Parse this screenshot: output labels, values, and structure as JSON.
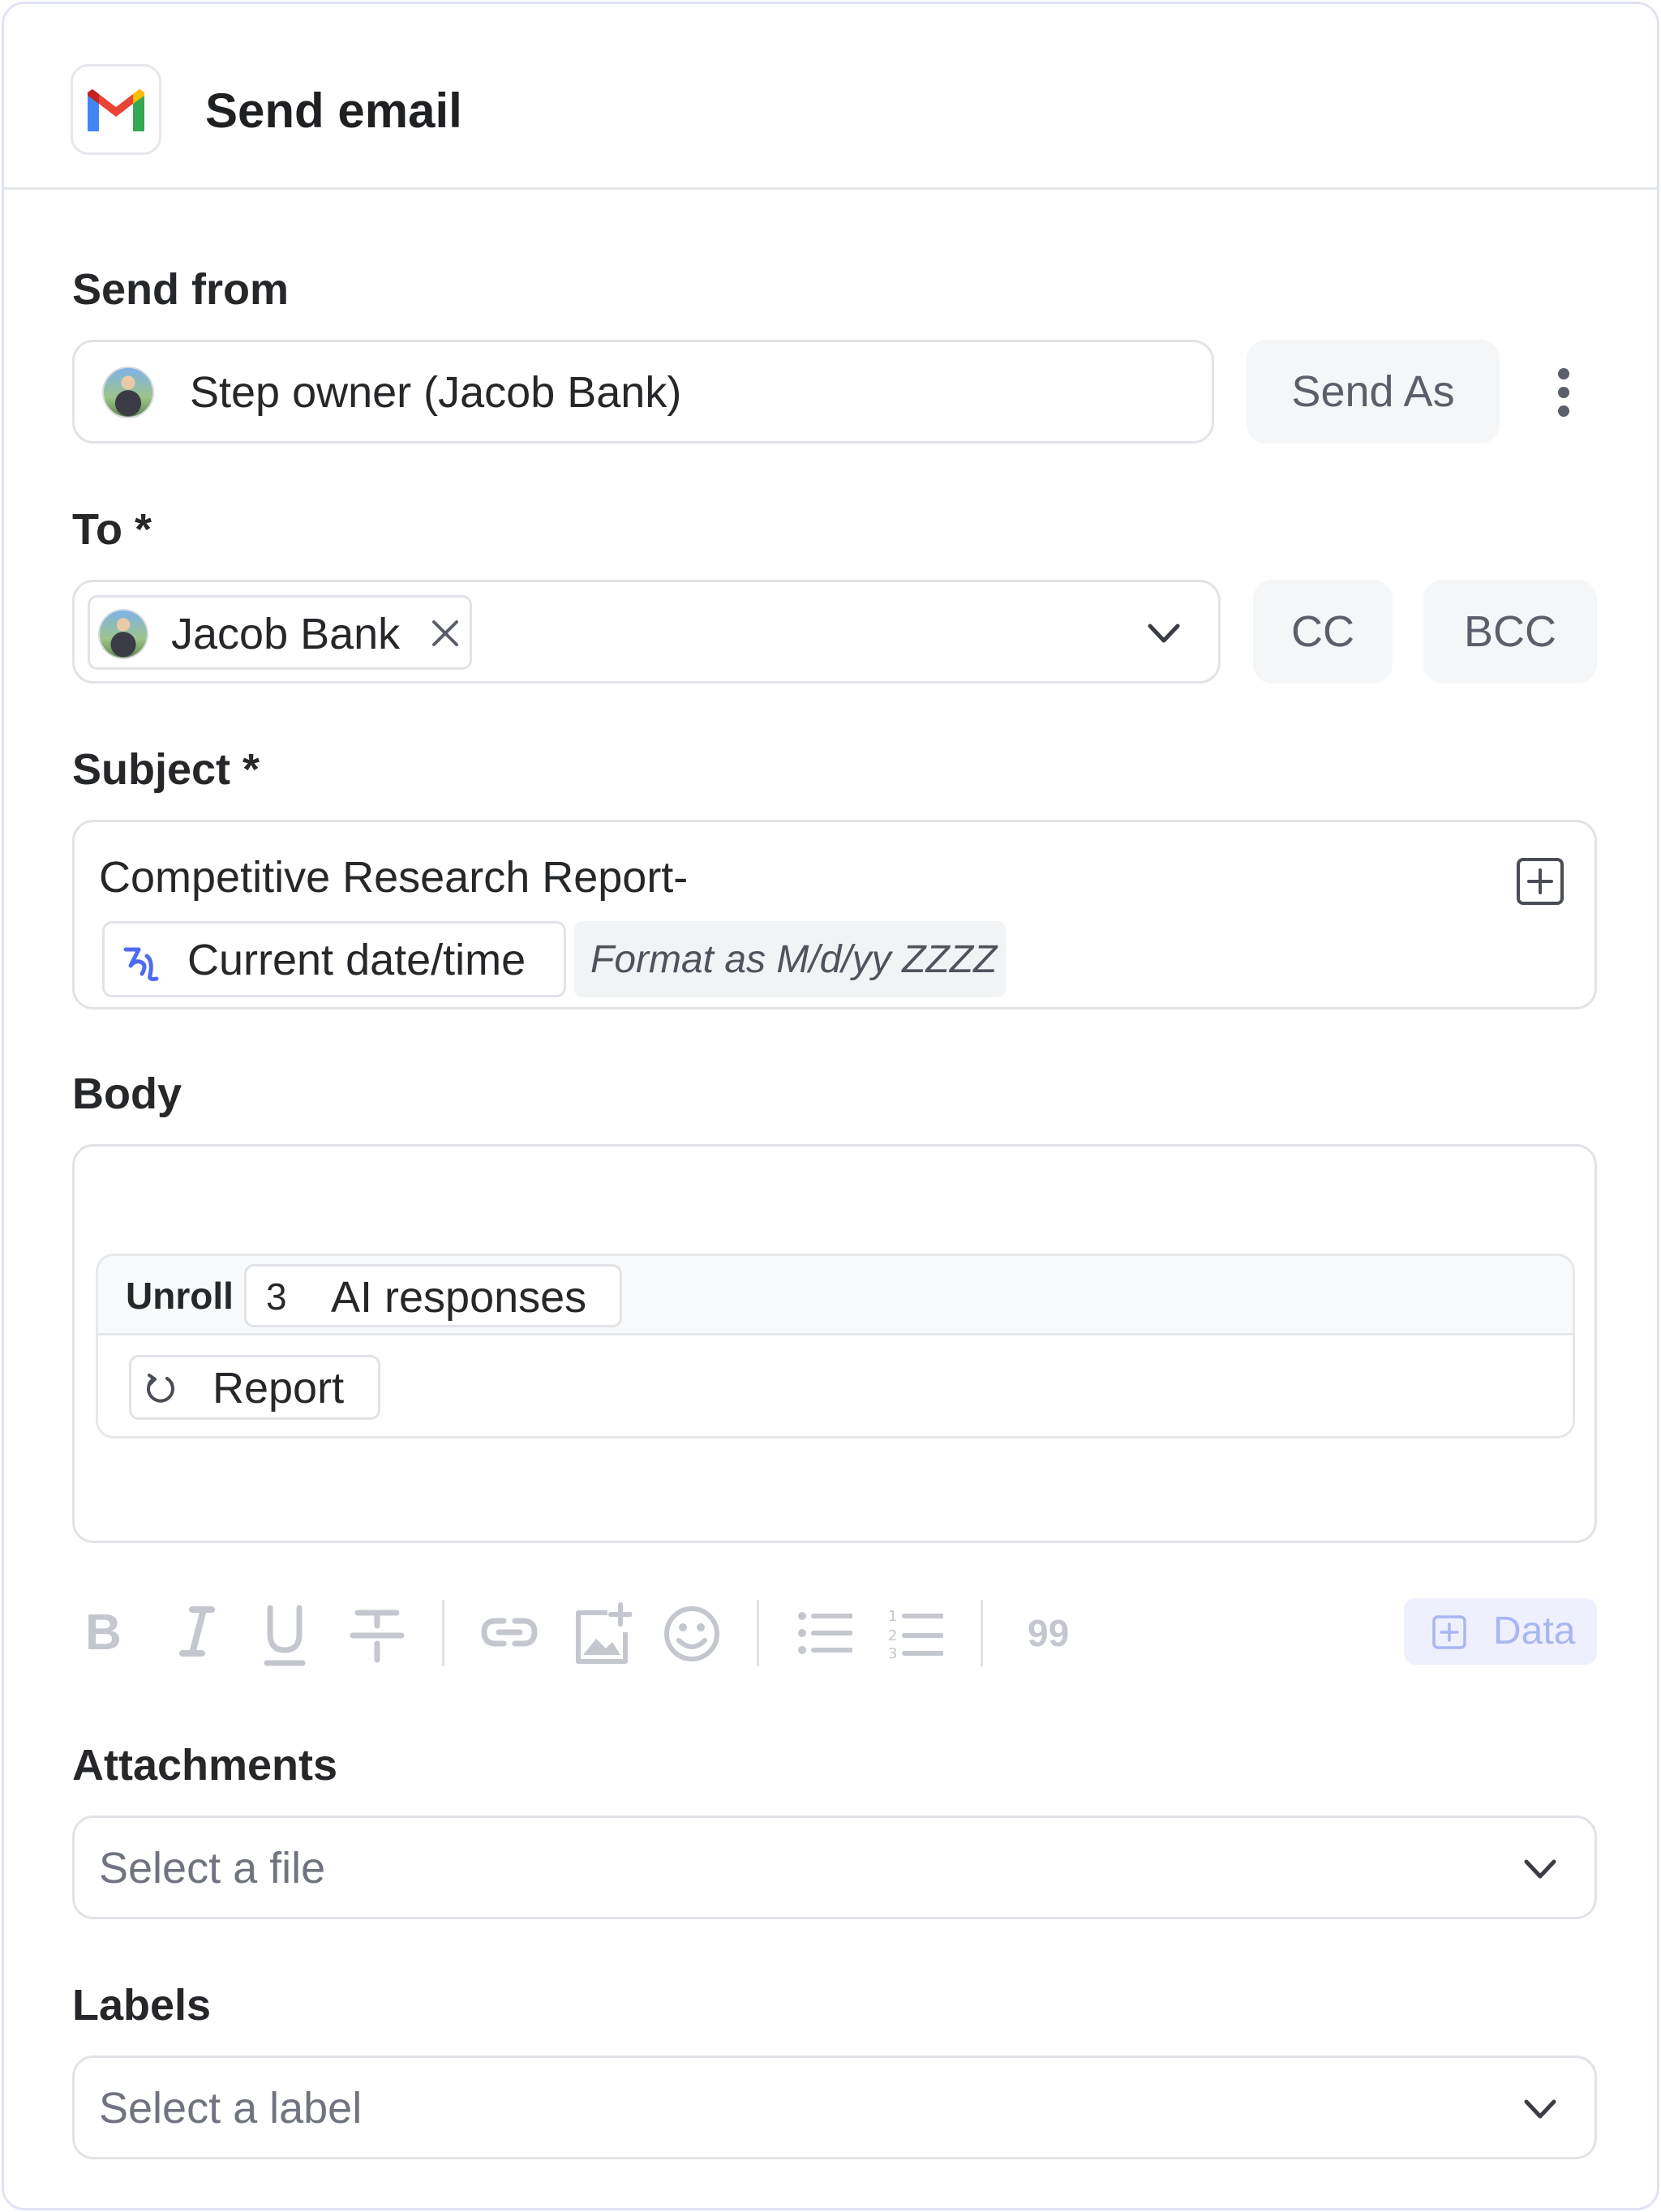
{
  "header": {
    "title": "Send email",
    "icon": "gmail-icon"
  },
  "send_from": {
    "label": "Send from",
    "value": "Step owner (Jacob Bank)",
    "send_as_label": "Send As",
    "more_icon": "more-vertical-icon"
  },
  "to": {
    "label": "To *",
    "recipient": "Jacob Bank",
    "cc_label": "CC",
    "bcc_label": "BCC"
  },
  "subject": {
    "label": "Subject *",
    "text": "Competitive Research Report-",
    "token_label": "Current date/time",
    "format_label": "Format as M/d/yy ZZZZ"
  },
  "body": {
    "label": "Body",
    "unroll_label": "Unroll",
    "unroll_count": "3",
    "unroll_source": "AI responses",
    "report_label": "Report"
  },
  "toolbar": {
    "bold": "B",
    "quote": "99",
    "data_label": "Data"
  },
  "attachments": {
    "label": "Attachments",
    "placeholder": "Select a file"
  },
  "labels": {
    "label": "Labels",
    "placeholder": "Select a label"
  },
  "colors": {
    "accent": "#4f6cf0",
    "border": "#e1e3e8",
    "muted": "#c4c7ce",
    "data_button_bg": "#eef1fd",
    "data_button_text": "#a9b6f3"
  }
}
